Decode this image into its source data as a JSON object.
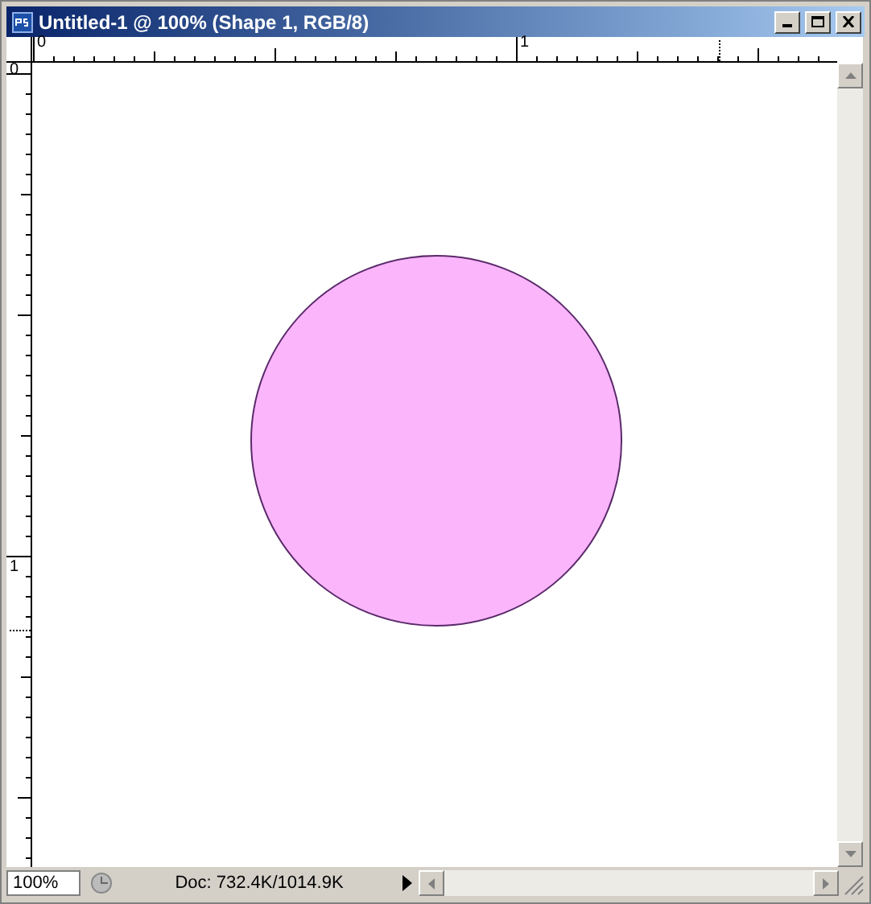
{
  "window": {
    "title": "Untitled-1 @ 100% (Shape 1, RGB/8)"
  },
  "rulers": {
    "horizontal_labels": [
      "0",
      "1"
    ],
    "vertical_labels": [
      "0",
      "1"
    ]
  },
  "status_bar": {
    "zoom": "100%",
    "info": "Doc: 732.4K/1014.9K"
  }
}
